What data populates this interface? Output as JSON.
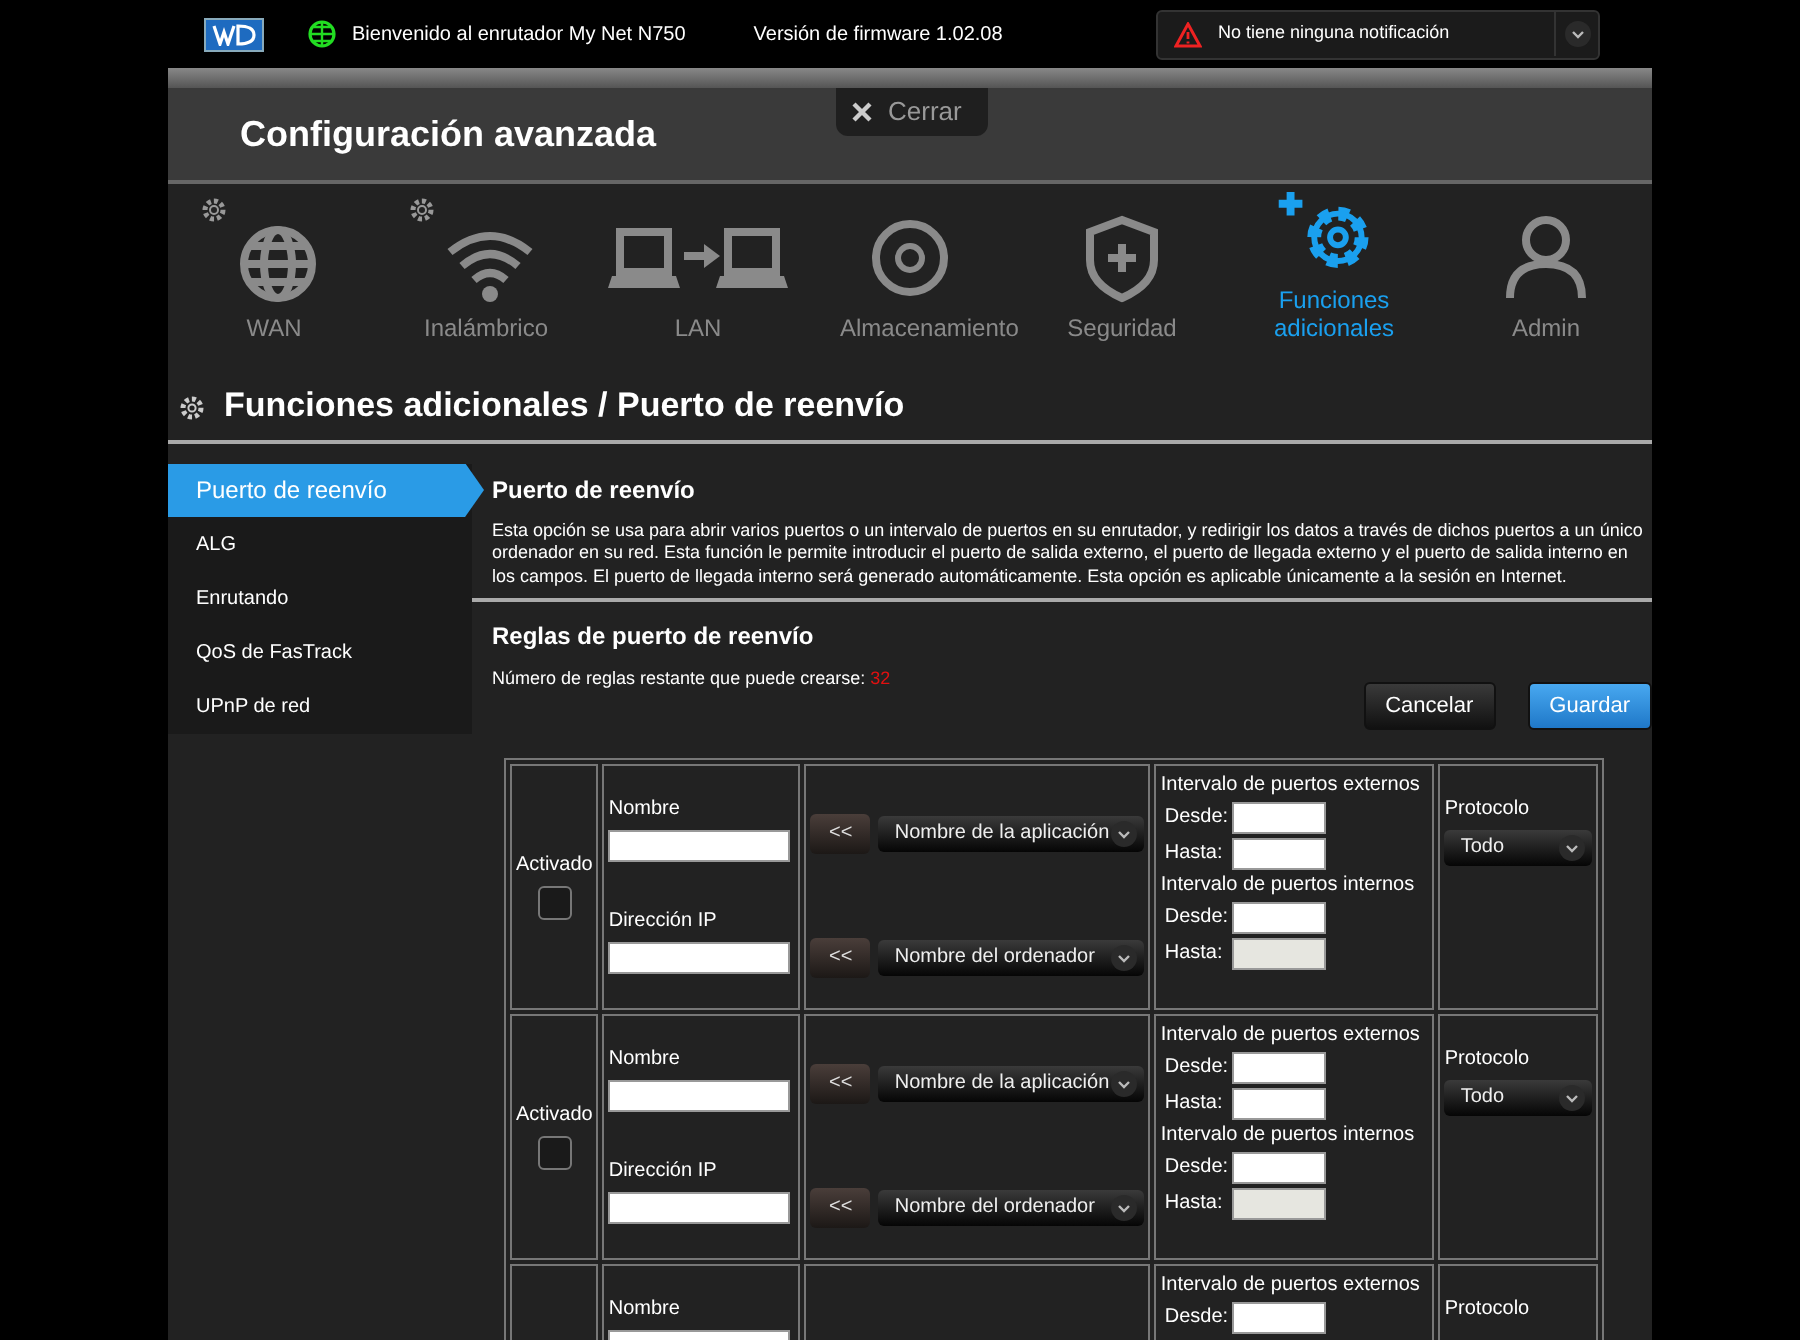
{
  "top_bar": {
    "welcome": "Bienvenido al enrutador My Net N750",
    "firmware": "Versión de firmware 1.02.08",
    "notification": "No tiene ninguna notificación"
  },
  "close_button": "Cerrar",
  "header": {
    "title": "Configuración avanzada"
  },
  "nav": [
    {
      "label": "WAN",
      "selected": false
    },
    {
      "label": "Inalámbrico",
      "selected": false
    },
    {
      "label": "LAN",
      "selected": false
    },
    {
      "label": "Almacenamiento",
      "selected": false
    },
    {
      "label": "Seguridad",
      "selected": false
    },
    {
      "label": "Funciones adicionales",
      "selected": true
    },
    {
      "label": "Admin",
      "selected": false
    }
  ],
  "page_title": "Funciones adicionales / Puerto de reenvío",
  "sidebar": [
    {
      "label": "Puerto de reenvío",
      "selected": true
    },
    {
      "label": "ALG",
      "selected": false
    },
    {
      "label": "Enrutando",
      "selected": false
    },
    {
      "label": "QoS de FasTrack",
      "selected": false
    },
    {
      "label": "UPnP de red",
      "selected": false
    }
  ],
  "section": {
    "title": "Puerto de reenvío",
    "description": "Esta opción se usa para abrir varios puertos o un intervalo de puertos en su enrutador, y redirigir los datos a través de dichos puertos a un único ordenador en su red. Esta función le permite introducir el puerto de salida externo, el puerto de llegada externo y el puerto de salida interno en los campos. El puerto de llegada interno será generado automáticamente. Esta opción es aplicable únicamente a la sesión en Internet."
  },
  "rules_section": {
    "title": "Reglas de puerto de reenvío",
    "remaining_label": "Número de reglas restante que puede crearse:",
    "remaining_count": "32",
    "buttons": [
      {
        "label": "Cancelar",
        "kind": "secondary"
      },
      {
        "label": "Guardar",
        "kind": "primary"
      }
    ]
  },
  "rules": [
    {
      "activated_label": "Activado",
      "checked": false,
      "name_label": "Nombre",
      "ip_label": "Dirección IP",
      "app_button": "<<",
      "app_select": "Nombre de la aplicación",
      "pc_button": "<<",
      "pc_select": "Nombre del ordenador",
      "ports": [
        {
          "title": "Intervalo de puertos externos",
          "rows": [
            {
              "label": "Desde:",
              "disabled": false
            },
            {
              "label": "Hasta:",
              "disabled": false
            }
          ]
        },
        {
          "title": "Intervalo de puertos internos",
          "rows": [
            {
              "label": "Desde:",
              "disabled": false
            },
            {
              "label": "Hasta:",
              "disabled": true
            }
          ]
        }
      ],
      "protocol_label": "Protocolo",
      "protocol": "Todo"
    },
    {
      "activated_label": "Activado",
      "checked": false,
      "name_label": "Nombre",
      "ip_label": "Dirección IP",
      "app_button": "<<",
      "app_select": "Nombre de la aplicación",
      "pc_button": "<<",
      "pc_select": "Nombre del ordenador",
      "ports": [
        {
          "title": "Intervalo de puertos externos",
          "rows": [
            {
              "label": "Desde:",
              "disabled": false
            },
            {
              "label": "Hasta:",
              "disabled": false
            }
          ]
        },
        {
          "title": "Intervalo de puertos internos",
          "rows": [
            {
              "label": "Desde:",
              "disabled": false
            },
            {
              "label": "Hasta:",
              "disabled": true
            }
          ]
        }
      ],
      "protocol_label": "Protocolo",
      "protocol": "Todo"
    },
    {
      "name_label": "Nombre",
      "ports": [
        {
          "title": "Intervalo de puertos externos",
          "rows": [
            {
              "label": "Desde:",
              "disabled": false
            }
          ]
        }
      ],
      "protocol_label": "Protocolo"
    }
  ]
}
